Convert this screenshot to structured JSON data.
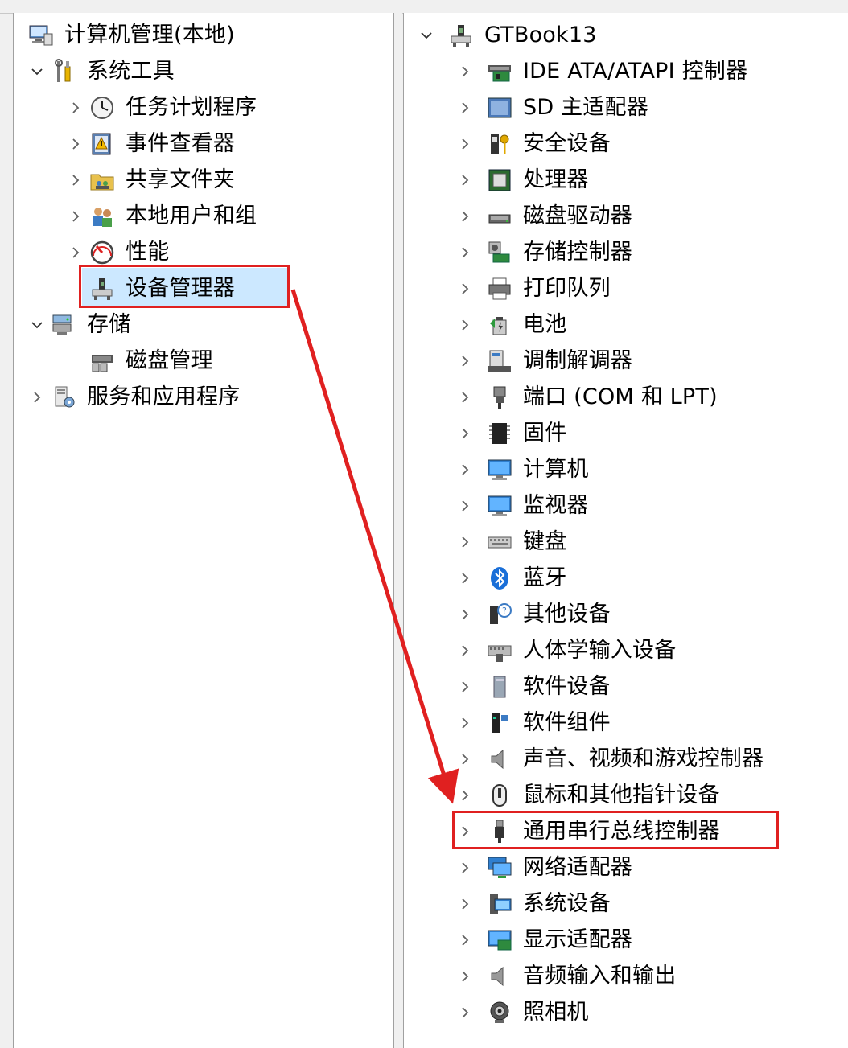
{
  "left_tree": [
    {
      "id": "computer-management",
      "label": "计算机管理(本地)",
      "icon": "computer-management-icon",
      "level": 0,
      "toggle": "none"
    },
    {
      "id": "system-tools",
      "label": "系统工具",
      "icon": "tools-icon",
      "level": 1,
      "toggle": "expanded"
    },
    {
      "id": "task-scheduler",
      "label": "任务计划程序",
      "icon": "clock-icon",
      "level": 2,
      "toggle": "collapsed"
    },
    {
      "id": "event-viewer",
      "label": "事件查看器",
      "icon": "event-viewer-icon",
      "level": 2,
      "toggle": "collapsed"
    },
    {
      "id": "shared-folders",
      "label": "共享文件夹",
      "icon": "shared-folder-icon",
      "level": 2,
      "toggle": "collapsed"
    },
    {
      "id": "local-users-groups",
      "label": "本地用户和组",
      "icon": "users-icon",
      "level": 2,
      "toggle": "collapsed"
    },
    {
      "id": "performance",
      "label": "性能",
      "icon": "performance-icon",
      "level": 2,
      "toggle": "collapsed"
    },
    {
      "id": "device-manager",
      "label": "设备管理器",
      "icon": "device-manager-icon",
      "level": 2,
      "toggle": "none",
      "selected": true
    },
    {
      "id": "storage",
      "label": "存储",
      "icon": "storage-icon",
      "level": 1,
      "toggle": "expanded"
    },
    {
      "id": "disk-management",
      "label": "磁盘管理",
      "icon": "disk-management-icon",
      "level": 2,
      "toggle": "none"
    },
    {
      "id": "services-apps",
      "label": "服务和应用程序",
      "icon": "services-icon",
      "level": 1,
      "toggle": "collapsed"
    }
  ],
  "right_tree": {
    "root": {
      "label": "GTBook13",
      "icon": "computer-root-icon",
      "toggle": "expanded"
    },
    "categories": [
      {
        "id": "ide",
        "label": "IDE ATA/ATAPI 控制器",
        "icon": "ide-controller-icon"
      },
      {
        "id": "sd",
        "label": "SD 主适配器",
        "icon": "sd-adapter-icon"
      },
      {
        "id": "security",
        "label": "安全设备",
        "icon": "security-key-icon"
      },
      {
        "id": "processors",
        "label": "处理器",
        "icon": "processor-icon"
      },
      {
        "id": "disk-drives",
        "label": "磁盘驱动器",
        "icon": "disk-drive-icon"
      },
      {
        "id": "storage-controllers",
        "label": "存储控制器",
        "icon": "storage-controller-icon"
      },
      {
        "id": "print-queues",
        "label": "打印队列",
        "icon": "printer-icon"
      },
      {
        "id": "batteries",
        "label": "电池",
        "icon": "battery-icon"
      },
      {
        "id": "modems",
        "label": "调制解调器",
        "icon": "modem-icon"
      },
      {
        "id": "ports",
        "label": "端口 (COM 和 LPT)",
        "icon": "port-icon"
      },
      {
        "id": "firmware",
        "label": "固件",
        "icon": "firmware-chip-icon"
      },
      {
        "id": "computer",
        "label": "计算机",
        "icon": "monitor-icon"
      },
      {
        "id": "monitors",
        "label": "监视器",
        "icon": "monitor-icon"
      },
      {
        "id": "keyboards",
        "label": "键盘",
        "icon": "keyboard-icon"
      },
      {
        "id": "bluetooth",
        "label": "蓝牙",
        "icon": "bluetooth-icon"
      },
      {
        "id": "other-devices",
        "label": "其他设备",
        "icon": "unknown-device-icon"
      },
      {
        "id": "hid",
        "label": "人体学输入设备",
        "icon": "hid-icon"
      },
      {
        "id": "software-devices",
        "label": "软件设备",
        "icon": "software-device-icon"
      },
      {
        "id": "software-components",
        "label": "软件组件",
        "icon": "software-component-icon"
      },
      {
        "id": "sound",
        "label": "声音、视频和游戏控制器",
        "icon": "speaker-icon"
      },
      {
        "id": "mice",
        "label": "鼠标和其他指针设备",
        "icon": "mouse-icon"
      },
      {
        "id": "usb",
        "label": "通用串行总线控制器",
        "icon": "usb-plug-icon",
        "highlighted": true
      },
      {
        "id": "network",
        "label": "网络适配器",
        "icon": "network-adapter-icon"
      },
      {
        "id": "system-devices",
        "label": "系统设备",
        "icon": "system-device-icon"
      },
      {
        "id": "display",
        "label": "显示适配器",
        "icon": "display-adapter-icon"
      },
      {
        "id": "audio-io",
        "label": "音频输入和输出",
        "icon": "speaker-icon"
      },
      {
        "id": "cameras",
        "label": "照相机",
        "icon": "camera-icon"
      }
    ]
  },
  "colors": {
    "selection": "#cce8ff",
    "annotation": "#e02020",
    "pane_border": "#a0a0a0"
  }
}
